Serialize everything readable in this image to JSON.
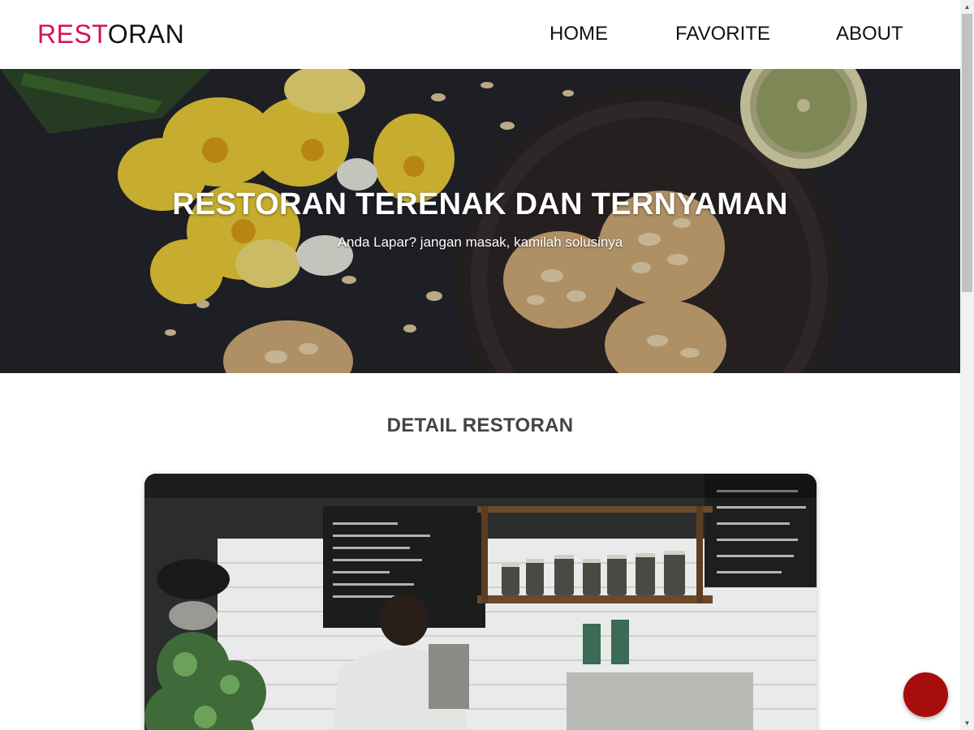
{
  "header": {
    "brand_accent": "REST",
    "brand_rest": "ORAN",
    "nav": {
      "home": "HOME",
      "favorite": "FAVORITE",
      "about": "ABOUT"
    }
  },
  "hero": {
    "title": "RESTORAN TERENAK DAN TERNYAMAN",
    "subtitle": "Anda Lapar? jangan masak, kamilah solusinya"
  },
  "detail": {
    "section_title": "DETAIL RESTORAN"
  },
  "colors": {
    "brand_accent": "#d6124d",
    "fab": "#a80d0d"
  },
  "icons": {
    "scroll_up": "scroll-up-arrow-icon",
    "scroll_down": "scroll-down-arrow-icon"
  }
}
